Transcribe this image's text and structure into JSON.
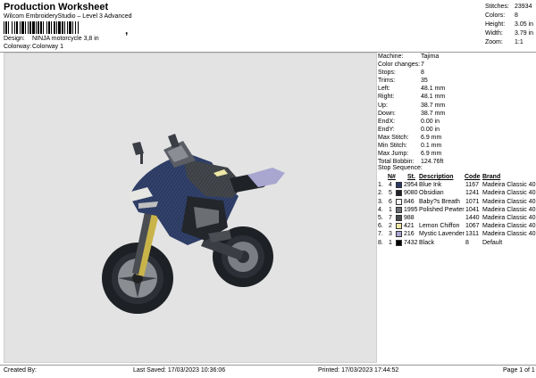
{
  "header": {
    "title": "Production Worksheet",
    "subtitle": "Wilcom EmbroideryStudio – Level 3 Advanced",
    "barcode_tail": ",",
    "design_label": "Design:",
    "design_value": "NINJA motorcycle 3,8 in",
    "colorway_label": "Colorway:",
    "colorway_value": "Colorway 1"
  },
  "summary": {
    "stitches_label": "Stitches:",
    "stitches": "23934",
    "colors_label": "Colors:",
    "colors": "8",
    "height_label": "Height:",
    "height": "3.05 in",
    "width_label": "Width:",
    "width": "3.79 in",
    "zoom_label": "Zoom:",
    "zoom": "1:1"
  },
  "machine": [
    {
      "k": "Machine:",
      "v": "Tajima"
    },
    {
      "k": "Color changes:",
      "v": "7"
    },
    {
      "k": "Stops:",
      "v": "8"
    },
    {
      "k": "Trims:",
      "v": "35"
    },
    {
      "k": "Left:",
      "v": "48.1 mm"
    },
    {
      "k": "Right:",
      "v": "48.1 mm"
    },
    {
      "k": "Up:",
      "v": "38.7 mm"
    },
    {
      "k": "Down:",
      "v": "38.7 mm"
    },
    {
      "k": "EndX:",
      "v": "0.00 in"
    },
    {
      "k": "EndY:",
      "v": "0.00 in"
    },
    {
      "k": "Max Stitch:",
      "v": "6.9 mm"
    },
    {
      "k": "Min Stitch:",
      "v": "0.1 mm"
    },
    {
      "k": "Max Jump:",
      "v": "6.9 mm"
    },
    {
      "k": "Total Bobbin:",
      "v": "124.76ft"
    }
  ],
  "stop_sequence": {
    "title": "Stop Sequence:",
    "headers": {
      "n": "N#",
      "st": "St.",
      "desc": "Description",
      "code": "Code",
      "brand": "Brand"
    },
    "rows": [
      {
        "i": "1.",
        "n": "4",
        "st": "2954",
        "desc": "Blue Ink",
        "code": "1167",
        "brand": "Madeira Classic 40",
        "color": "#2a3a63"
      },
      {
        "i": "2.",
        "n": "5",
        "st": "9080",
        "desc": "Obsidian",
        "code": "1241",
        "brand": "Madeira Classic 40",
        "color": "#1f2328"
      },
      {
        "i": "3.",
        "n": "6",
        "st": "846",
        "desc": "Baby?s Breath",
        "code": "1071",
        "brand": "Madeira Classic 40",
        "color": "#f3f3f0"
      },
      {
        "i": "4.",
        "n": "1",
        "st": "1995",
        "desc": "Polished Pewter",
        "code": "1041",
        "brand": "Madeira Classic 40",
        "color": "#6b6e72"
      },
      {
        "i": "5.",
        "n": "7",
        "st": "988",
        "desc": "",
        "code": "1440",
        "brand": "Madeira Classic 40",
        "color": "#4a4d52"
      },
      {
        "i": "6.",
        "n": "2",
        "st": "421",
        "desc": "Lemon Chiffon",
        "code": "1067",
        "brand": "Madeira Classic 40",
        "color": "#efe7a6"
      },
      {
        "i": "7.",
        "n": "3",
        "st": "216",
        "desc": "Mystic Lavender",
        "code": "1311",
        "brand": "Madeira Classic 40",
        "color": "#a7a4cf"
      },
      {
        "i": "8.",
        "n": "1",
        "st": "7432",
        "desc": "Black",
        "code": "8",
        "brand": "Default",
        "color": "#000000"
      }
    ]
  },
  "footer": {
    "created_by": "Created By:",
    "last_saved": "Last Saved: 17/03/2023 10:36:06",
    "printed": "Printed: 17/03/2023 17:44:52",
    "page": "Page 1 of 1"
  }
}
